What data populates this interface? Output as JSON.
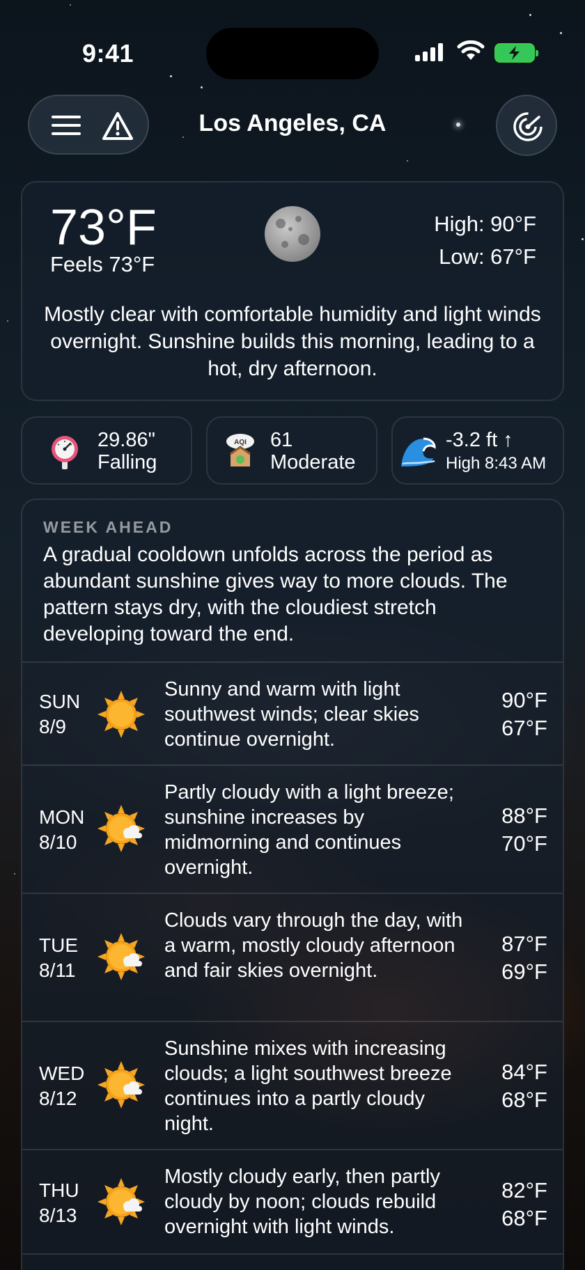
{
  "status_bar": {
    "time": "9:41"
  },
  "header": {
    "city": "Los Angeles, CA"
  },
  "current": {
    "temperature": "73°F",
    "feels_like": "Feels 73°F",
    "high": "High: 90°F",
    "low": "Low: 67°F",
    "condition_icon": "moon-icon",
    "summary": "Mostly clear with comfortable humidity and light winds overnight. Sunshine builds this morning, leading to a hot, dry afternoon."
  },
  "pressure": {
    "value": "29.86\"",
    "trend": "Falling",
    "icon": "barometer-icon"
  },
  "aqi": {
    "value": "61",
    "category": "Moderate",
    "icon": "aqi-icon"
  },
  "tide": {
    "value": "-3.2 ft ↑",
    "next": "High 8:43 AM",
    "icon": "wave-icon"
  },
  "week": {
    "title": "WEEK AHEAD",
    "summary": "A gradual cooldown unfolds across the period as abundant sunshine gives way to more clouds. The pattern stays dry, with the cloudiest stretch developing toward the end.",
    "days": [
      {
        "day": "SUN",
        "date": "8/9",
        "icon": "sun-icon",
        "desc": "Sunny and warm with light southwest winds; clear skies continue overnight.",
        "high": "90°F",
        "low": "67°F"
      },
      {
        "day": "MON",
        "date": "8/10",
        "icon": "partly-sunny-icon",
        "desc": "Partly cloudy with a light breeze; sunshine increases by midmorning and continues overnight.",
        "high": "88°F",
        "low": "70°F"
      },
      {
        "day": "TUE",
        "date": "8/11",
        "icon": "partly-sunny-icon",
        "desc": "Clouds vary through the day, with a warm, mostly cloudy afternoon and fair skies overnight.",
        "high": "87°F",
        "low": "69°F"
      },
      {
        "day": "WED",
        "date": "8/12",
        "icon": "partly-sunny-icon",
        "desc": "Sunshine mixes with increasing clouds; a light southwest breeze continues into a partly cloudy night.",
        "high": "84°F",
        "low": "68°F"
      },
      {
        "day": "THU",
        "date": "8/13",
        "icon": "partly-sunny-icon",
        "desc": "Mostly cloudy early, then partly cloudy by noon; clouds rebuild overnight with light winds.",
        "high": "82°F",
        "low": "68°F"
      }
    ]
  }
}
